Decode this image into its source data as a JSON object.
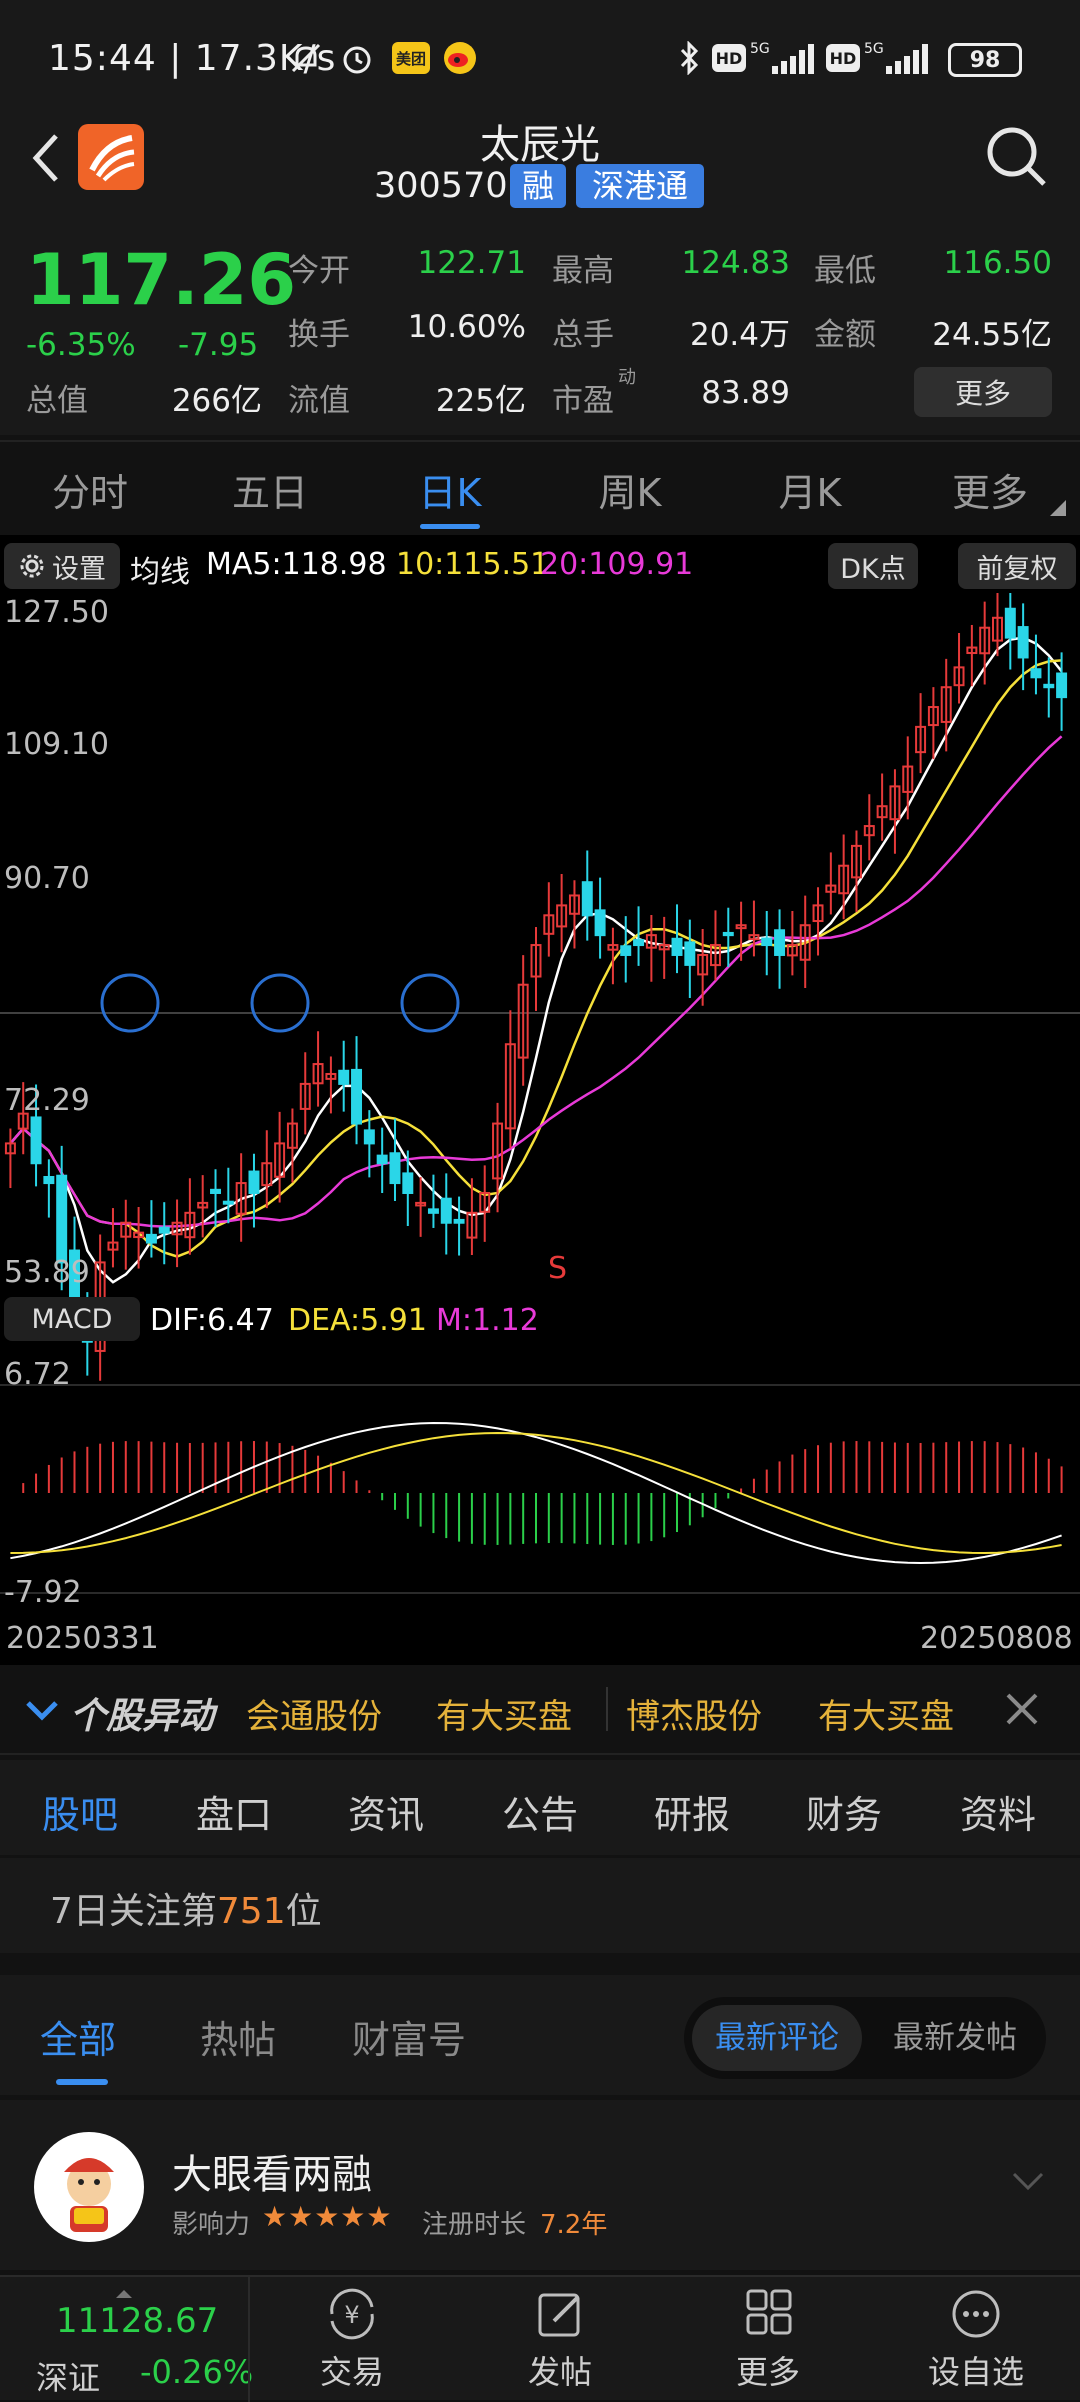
{
  "status_bar": {
    "time_speed": "15:44 | 17.3K/s",
    "badge_meituan": "美团",
    "battery": "98",
    "net1": "HD",
    "net2": "5G",
    "net3": "HD",
    "net4": "5G"
  },
  "header": {
    "stock_name": "太辰光",
    "stock_code": "300570",
    "tag_margin": "融",
    "tag_connect": "深港通"
  },
  "quote": {
    "price": "117.26",
    "change_pct": "-6.35%",
    "change": "-7.95",
    "rows": [
      [
        {
          "label": "今开",
          "value": "122.71",
          "green": true
        },
        {
          "label": "最高",
          "value": "124.83",
          "green": true
        },
        {
          "label": "最低",
          "value": "116.50",
          "green": true
        }
      ],
      [
        {
          "label": "换手",
          "value": "10.60%",
          "green": false
        },
        {
          "label": "总手",
          "value": "20.4万",
          "green": false
        },
        {
          "label": "金额",
          "value": "24.55亿",
          "green": false
        }
      ],
      [
        {
          "label": "总值",
          "value": "266亿",
          "green": false
        },
        {
          "label": "流值",
          "value": "225亿",
          "green": false
        },
        {
          "label": "市盈",
          "value": "83.89",
          "green": false
        }
      ]
    ],
    "pe_sup": "动",
    "total_label": "总值",
    "total_value": "266亿",
    "more_button": "更多"
  },
  "chart_tabs": [
    "分时",
    "五日",
    "日K",
    "周K",
    "月K",
    "更多"
  ],
  "active_chart_tab": 2,
  "ma_bar": {
    "settings": "设置",
    "title": "均线",
    "ma5": "MA5:118.98",
    "ma10": "10:115.51",
    "ma20": "20:109.91",
    "dk_button": "DK点",
    "adjust_button": "前复权"
  },
  "price_axis": [
    "127.50",
    "109.10",
    "90.70",
    "72.29",
    "53.89"
  ],
  "signal_label": "S",
  "macd": {
    "label": "MACD",
    "dif": "DIF:6.47",
    "dea": "DEA:5.91",
    "m": "M:1.12",
    "top": "6.72",
    "bottom": "-7.92"
  },
  "date_start": "20250331",
  "date_end": "20250808",
  "alert": {
    "title": "个股异动",
    "items": [
      "会通股份",
      "有大买盘",
      "博杰股份",
      "有大买盘"
    ]
  },
  "section_tabs": [
    "股吧",
    "盘口",
    "资讯",
    "公告",
    "研报",
    "财务",
    "资料"
  ],
  "rank": {
    "prefix": "7日关注第",
    "number": "751",
    "suffix": "位"
  },
  "filters": {
    "tabs": [
      "全部",
      "热帖",
      "财富号"
    ],
    "sort_active": "最新评论",
    "sort_other": "最新发帖"
  },
  "post": {
    "author": "大眼看两融",
    "influence_label": "影响力",
    "stars": "★★★★★",
    "reg_label": "注册时长",
    "reg_value": "7.2年"
  },
  "bottom_nav": {
    "index_value": "11128.67",
    "index_name": "深证",
    "index_change": "-0.26%",
    "items": [
      "交易",
      "发帖",
      "更多",
      "设自选"
    ]
  },
  "colors": {
    "up": "#e63a3a",
    "down": "#2ad6e8",
    "green": "#2bd04a",
    "ma5": "#ffffff",
    "ma10": "#f5e03a",
    "ma20": "#e83ad8",
    "accent": "#3a8ef0",
    "orange": "#f08a3a",
    "gold": "#e5b23a"
  }
}
